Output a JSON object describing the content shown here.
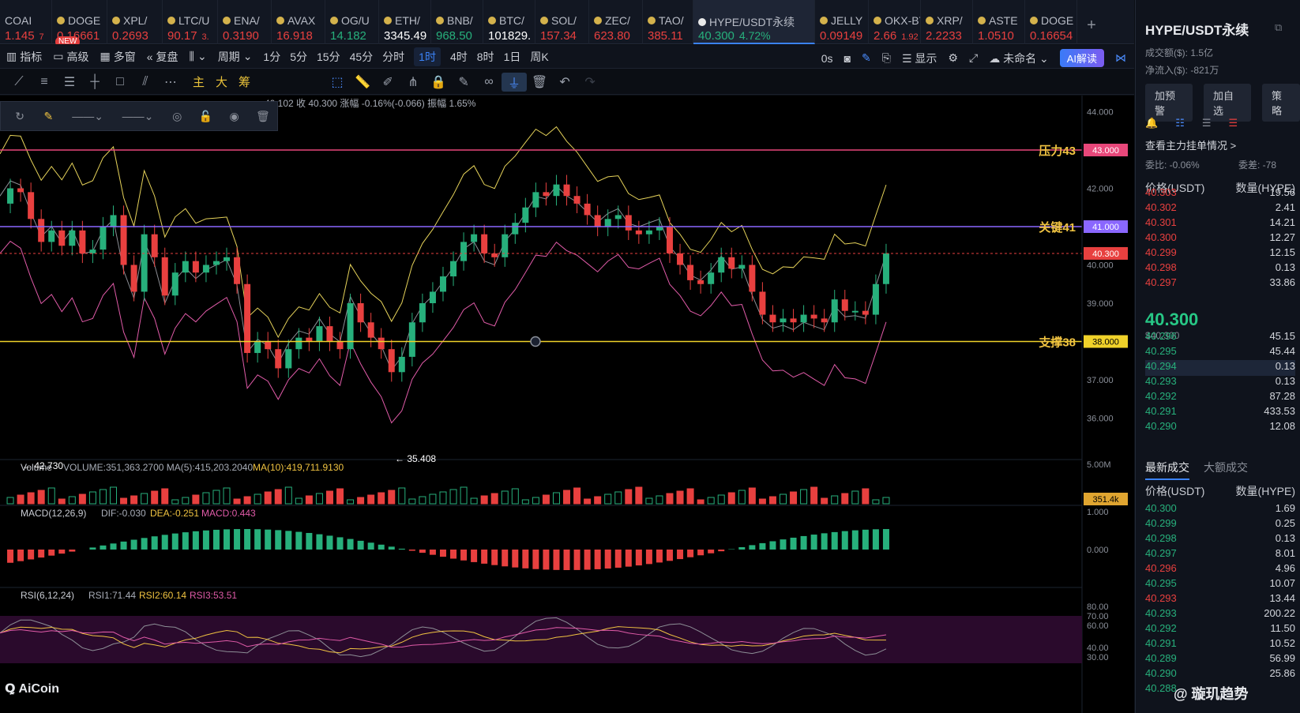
{
  "tabs": [
    {
      "name": "COAI",
      "price": "1.145",
      "change": "7",
      "color": "#e8403f"
    },
    {
      "name": "DOGE",
      "price": "0.16661",
      "change": "",
      "color": "#e8403f",
      "badge": "NEW"
    },
    {
      "name": "XPL/",
      "price": "0.2693",
      "change": "",
      "color": "#e8403f"
    },
    {
      "name": "LTC/U",
      "price": "90.17",
      "change": "3.",
      "color": "#e8403f"
    },
    {
      "name": "ENA/",
      "price": "0.3190",
      "change": "",
      "color": "#e8403f"
    },
    {
      "name": "AVAX",
      "price": "16.918",
      "change": "",
      "color": "#e8403f"
    },
    {
      "name": "OG/U",
      "price": "14.182",
      "change": "",
      "color": "#27b07c"
    },
    {
      "name": "ETH/",
      "price": "3345.49",
      "change": "",
      "color": "#ffffff"
    },
    {
      "name": "BNB/",
      "price": "968.50",
      "change": "",
      "color": "#27b07c"
    },
    {
      "name": "BTC/",
      "price": "101829.",
      "change": "",
      "color": "#ffffff"
    },
    {
      "name": "SOL/",
      "price": "157.34",
      "change": "",
      "color": "#e8403f"
    },
    {
      "name": "ZEC/",
      "price": "623.80",
      "change": "",
      "color": "#e8403f"
    },
    {
      "name": "TAO/",
      "price": "385.11",
      "change": "",
      "color": "#e8403f"
    },
    {
      "name": "HYPE/USDT永续",
      "price": "40.300",
      "change": "4.72%",
      "color": "#27b07c",
      "active": true
    },
    {
      "name": "JELLY",
      "price": "0.09149",
      "change": "",
      "color": "#e8403f"
    },
    {
      "name": "OKX-BTC",
      "price": "2.66",
      "change": "1.92",
      "color": "#e8403f"
    },
    {
      "name": "XRP/",
      "price": "2.2233",
      "change": "",
      "color": "#e8403f"
    },
    {
      "name": "ASTE",
      "price": "1.0510",
      "change": "",
      "color": "#e8403f"
    },
    {
      "name": "DOGE",
      "price": "0.16654",
      "change": "",
      "color": "#e8403f"
    }
  ],
  "toolbar": {
    "items": [
      "指标",
      "高级",
      "多窗",
      "复盘",
      "周期"
    ],
    "periods": [
      "1分",
      "5分",
      "15分",
      "45分",
      "分时",
      "1时",
      "4时",
      "8时",
      "1日",
      "周K"
    ],
    "active_period": "1时",
    "right": {
      "count": "0s",
      "display": "显示",
      "layout": "未命名",
      "ai": "AI解读"
    }
  },
  "drawing": {
    "chips": [
      "主",
      "大",
      "筹"
    ]
  },
  "ohlc": {
    "text": "40.102 收 40.300 涨幅 -0.16%(-0.066) 振幅 1.65%"
  },
  "chart": {
    "levels": [
      {
        "label": "压力43",
        "value": "43.000",
        "color": "#e8477a"
      },
      {
        "label": "关键41",
        "value": "41.000",
        "color": "#8a67ff"
      },
      {
        "label": "支撑38",
        "value": "38.000",
        "color": "#f0d22a"
      }
    ],
    "current": "40.300",
    "ymarks": [
      "44.000",
      "42.000",
      "40.000",
      "39.000",
      "37.000",
      "36.000"
    ],
    "high": "← 42.730",
    "low": "← 35.408"
  },
  "volume": {
    "label": "Volume",
    "text": "VOLUME:351,363.2700  MA(5):415,203.2040",
    "ma10": "MA(10):419,711.9130",
    "axis_top": "5.00M",
    "badge": "351.4k"
  },
  "macd": {
    "label": "MACD(12,26,9)",
    "dif": "DIF:-0.030",
    "dea": "DEA:-0.251",
    "macd": "MACD:0.443",
    "axis": [
      "1.000",
      "0.000"
    ]
  },
  "rsi": {
    "label": "RSI(6,12,24)",
    "r1": "RSI1:71.44",
    "r2": "RSI2:60.14",
    "r3": "RSI3:53.51",
    "axis": [
      "80.00",
      "70.00",
      "60.00",
      "40.00",
      "30.00"
    ]
  },
  "brand": "AiCoin",
  "watermark": "@ 璇玑趋势",
  "side": {
    "title": "HYPE/USDT永续",
    "turnover": "成交额($): 1.5亿",
    "inflow": "净流入($): -821万",
    "buttons": [
      "加预警",
      "加自选",
      "策略"
    ],
    "depth_link": "查看主力挂单情况 >",
    "wb": "委比: -0.06%",
    "wc": "委差: -78",
    "col1": "价格(USDT)",
    "col2": "数量(HYPE)",
    "asks": [
      [
        "40.303",
        "19.56"
      ],
      [
        "40.302",
        "2.41"
      ],
      [
        "40.301",
        "14.21"
      ],
      [
        "40.300",
        "12.27"
      ],
      [
        "40.299",
        "12.15"
      ],
      [
        "40.298",
        "0.13"
      ],
      [
        "40.297",
        "33.86"
      ]
    ],
    "last": "40.300",
    "last_usd": "$40.300",
    "bids": [
      [
        "40.296",
        "45.15"
      ],
      [
        "40.295",
        "45.44"
      ],
      [
        "40.294",
        "0.13"
      ],
      [
        "40.293",
        "0.13"
      ],
      [
        "40.292",
        "87.28"
      ],
      [
        "40.291",
        "433.53"
      ],
      [
        "40.290",
        "12.08"
      ]
    ],
    "trade_tabs": [
      "最新成交",
      "大额成交"
    ],
    "trades": [
      [
        "40.300",
        "1.69",
        "g"
      ],
      [
        "40.299",
        "0.25",
        "g"
      ],
      [
        "40.298",
        "0.13",
        "g"
      ],
      [
        "40.297",
        "8.01",
        "g"
      ],
      [
        "40.296",
        "4.96",
        "r"
      ],
      [
        "40.295",
        "10.07",
        "g"
      ],
      [
        "40.293",
        "13.44",
        "r"
      ],
      [
        "40.293",
        "200.22",
        "g"
      ],
      [
        "40.292",
        "11.50",
        "g"
      ],
      [
        "40.291",
        "10.52",
        "g"
      ],
      [
        "40.289",
        "56.99",
        "g"
      ],
      [
        "40.290",
        "25.86",
        "g"
      ],
      [
        "40.288",
        "",
        "g"
      ]
    ]
  }
}
